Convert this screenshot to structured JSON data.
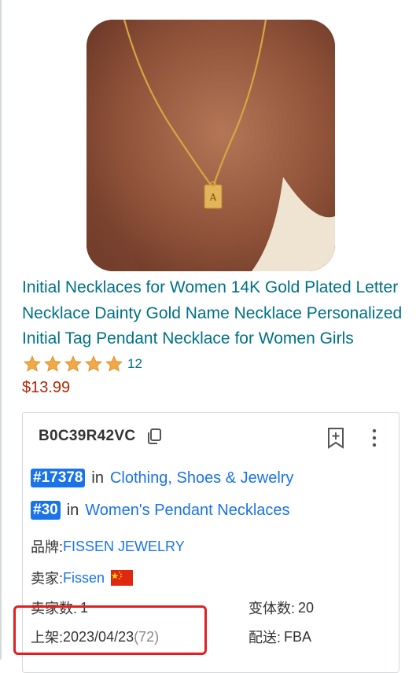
{
  "product": {
    "title": "Initial Necklaces for Women 14K Gold Plated Letter Necklace Dainty Gold Name Necklace Personalized Initial Tag Pendant Necklace for Women Girls",
    "rating": 5,
    "review_count": "12",
    "price": "$13.99",
    "image_icon": "gold-initial-necklace-photo",
    "pendant_letter": "A"
  },
  "panel": {
    "asin": "B0C39R42VC",
    "ranks": [
      {
        "badge": "#17378",
        "in": "in",
        "category": "Clothing, Shoes & Jewelry"
      },
      {
        "badge": "#30",
        "in": "in",
        "category": "Women's Pendant Necklaces"
      }
    ],
    "brand_label": "品牌:",
    "brand_value": "FISSEN JEWELRY",
    "seller_label": "卖家:",
    "seller_value": "Fissen",
    "seller_flag": "china-flag",
    "seller_count_label": "卖家数:",
    "seller_count_value": "1",
    "variants_label": "变体数:",
    "variants_value": "20",
    "listed_label": "上架:",
    "listed_date": "2023/04/23",
    "listed_days": "(72)",
    "shipping_label": "配送:",
    "shipping_value": "FBA"
  },
  "colors": {
    "link": "#007185",
    "price": "#b12704",
    "star": "#f3a847",
    "rank_badge": "#1a73e8",
    "highlight": "#e02020"
  }
}
